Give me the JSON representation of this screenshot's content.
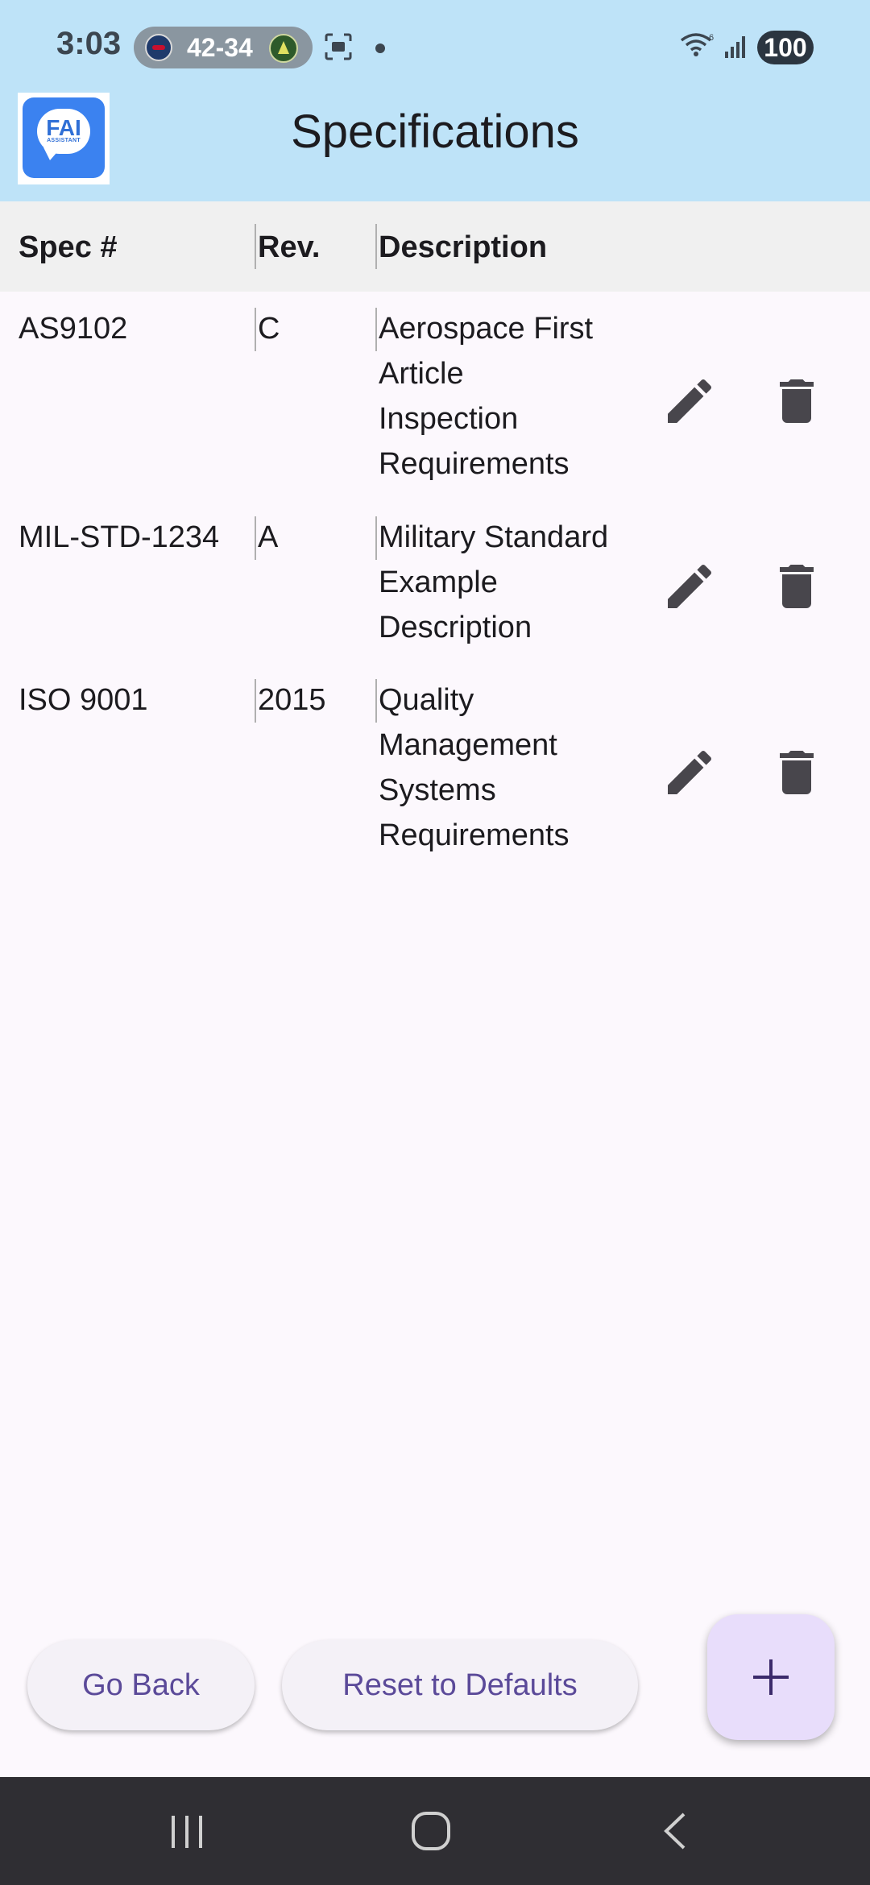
{
  "status_bar": {
    "time": "3:03",
    "score": "42-34",
    "battery": "100"
  },
  "app_bar": {
    "title": "Specifications",
    "logo_text": "FAI",
    "logo_subtext": "ASSISTANT"
  },
  "table": {
    "columns": [
      "Spec #",
      "Rev.",
      "Description"
    ],
    "rows": [
      {
        "spec": "AS9102",
        "rev": "C",
        "description": [
          "Aerospace First",
          "Article",
          "Inspection",
          "Requirements"
        ]
      },
      {
        "spec": "MIL-STD-1234",
        "rev": "A",
        "description": [
          "Military Standard",
          "Example",
          "Description"
        ]
      },
      {
        "spec": "ISO 9001",
        "rev": "2015",
        "description": [
          "Quality",
          "Management",
          "Systems",
          "Requirements"
        ]
      }
    ]
  },
  "actions": {
    "go_back": "Go Back",
    "reset": "Reset to Defaults"
  },
  "icons": {
    "edit": "pencil-icon",
    "delete": "trash-icon",
    "add": "plus-icon"
  },
  "colors": {
    "app_bar": "#bee3f8",
    "accent": "#5b4a99",
    "fab": "#e8ddfb"
  }
}
